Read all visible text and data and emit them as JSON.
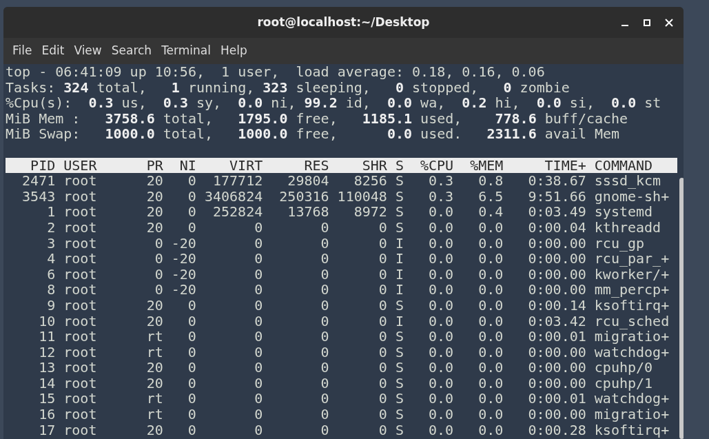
{
  "window": {
    "title": "root@localhost:~/Desktop"
  },
  "menu": [
    "File",
    "Edit",
    "View",
    "Search",
    "Terminal",
    "Help"
  ],
  "summary_lines": [
    "top - 06:41:09 up 10:56,  1 user,  load average: 0.18, 0.16, 0.06",
    "Tasks: **324** total,   **1** running, **323** sleeping,   **0** stopped,   **0** zombie",
    "%Cpu(s):  **0.3** us,  **0.3** sy,  **0.0** ni, **99.2** id,  **0.0** wa,  **0.2** hi,  **0.0** si,  **0.0** st",
    "MiB Mem :   **3758.6** total,   **1795.0** free,   **1185.1** used,    **778.6** buff/cache",
    "MiB Swap:   **1000.0** total,   **1000.0** free,      **0.0** used.   **2311.6** avail Mem"
  ],
  "table": {
    "columns": [
      "PID",
      "USER",
      "PR",
      "NI",
      "VIRT",
      "RES",
      "SHR",
      "S",
      "%CPU",
      "%MEM",
      "TIME+",
      "COMMAND"
    ],
    "rows": [
      [
        "2471",
        "root",
        "20",
        "0",
        "177712",
        "29804",
        "8256",
        "S",
        "0.3",
        "0.8",
        "0:38.67",
        "sssd_kcm"
      ],
      [
        "3543",
        "root",
        "20",
        "0",
        "3406824",
        "250316",
        "110048",
        "S",
        "0.3",
        "6.5",
        "9:51.66",
        "gnome-sh+"
      ],
      [
        "1",
        "root",
        "20",
        "0",
        "252824",
        "13768",
        "8972",
        "S",
        "0.0",
        "0.4",
        "0:03.49",
        "systemd"
      ],
      [
        "2",
        "root",
        "20",
        "0",
        "0",
        "0",
        "0",
        "S",
        "0.0",
        "0.0",
        "0:00.04",
        "kthreadd"
      ],
      [
        "3",
        "root",
        "0",
        "-20",
        "0",
        "0",
        "0",
        "I",
        "0.0",
        "0.0",
        "0:00.00",
        "rcu_gp"
      ],
      [
        "4",
        "root",
        "0",
        "-20",
        "0",
        "0",
        "0",
        "I",
        "0.0",
        "0.0",
        "0:00.00",
        "rcu_par_+"
      ],
      [
        "6",
        "root",
        "0",
        "-20",
        "0",
        "0",
        "0",
        "I",
        "0.0",
        "0.0",
        "0:00.00",
        "kworker/+"
      ],
      [
        "8",
        "root",
        "0",
        "-20",
        "0",
        "0",
        "0",
        "I",
        "0.0",
        "0.0",
        "0:00.00",
        "mm_percp+"
      ],
      [
        "9",
        "root",
        "20",
        "0",
        "0",
        "0",
        "0",
        "S",
        "0.0",
        "0.0",
        "0:00.14",
        "ksoftirq+"
      ],
      [
        "10",
        "root",
        "20",
        "0",
        "0",
        "0",
        "0",
        "I",
        "0.0",
        "0.0",
        "0:03.42",
        "rcu_sched"
      ],
      [
        "11",
        "root",
        "rt",
        "0",
        "0",
        "0",
        "0",
        "S",
        "0.0",
        "0.0",
        "0:00.01",
        "migratio+"
      ],
      [
        "12",
        "root",
        "rt",
        "0",
        "0",
        "0",
        "0",
        "S",
        "0.0",
        "0.0",
        "0:00.00",
        "watchdog+"
      ],
      [
        "13",
        "root",
        "20",
        "0",
        "0",
        "0",
        "0",
        "S",
        "0.0",
        "0.0",
        "0:00.00",
        "cpuhp/0"
      ],
      [
        "14",
        "root",
        "20",
        "0",
        "0",
        "0",
        "0",
        "S",
        "0.0",
        "0.0",
        "0:00.00",
        "cpuhp/1"
      ],
      [
        "15",
        "root",
        "rt",
        "0",
        "0",
        "0",
        "0",
        "S",
        "0.0",
        "0.0",
        "0:00.01",
        "watchdog+"
      ],
      [
        "16",
        "root",
        "rt",
        "0",
        "0",
        "0",
        "0",
        "S",
        "0.0",
        "0.0",
        "0:00.00",
        "migratio+"
      ],
      [
        "17",
        "root",
        "20",
        "0",
        "0",
        "0",
        "0",
        "S",
        "0.0",
        "0.0",
        "0:00.28",
        "ksoftirq+"
      ]
    ]
  }
}
